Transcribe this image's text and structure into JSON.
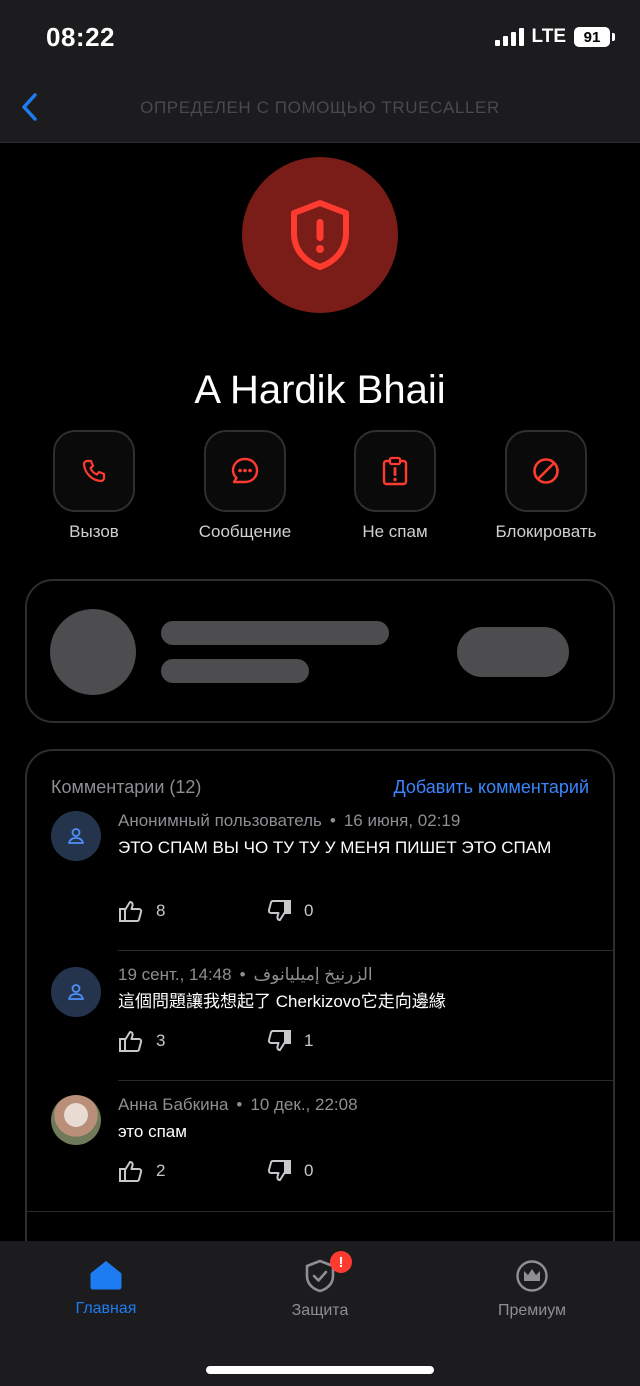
{
  "status": {
    "time": "08:22",
    "network": "LTE",
    "battery": "91"
  },
  "nav": {
    "title": "ОПРЕДЕЛЕН С ПОМОЩЬЮ TRUECALLER"
  },
  "contact": {
    "name": "A Hardik Bhaii"
  },
  "actions": [
    {
      "label": "Вызов",
      "icon": "phone-icon"
    },
    {
      "label": "Сообщение",
      "icon": "chat-bubble-icon"
    },
    {
      "label": "Не спам",
      "icon": "clipboard-alert-icon"
    },
    {
      "label": "Блокировать",
      "icon": "block-icon"
    }
  ],
  "comments": {
    "title": "Комментарии (12)",
    "add_label": "Добавить комментарий",
    "items": [
      {
        "author": "Анонимный пользователь",
        "date": "16 июня, 02:19",
        "text": "ЭТО СПАМ ВЫ ЧО ТУ ТУ  У МЕНЯ ПИШЕТ ЭТО СПАМ",
        "likes": "8",
        "dislikes": "0"
      },
      {
        "author": "الزرنيخ إميليانوف",
        "date": "19 сент., 14:48",
        "text": "這個問題讓我想起了 Cherkizovo它走向邊緣",
        "likes": "3",
        "dislikes": "1"
      },
      {
        "author": "Анна Бабкина",
        "date": "10 дек., 22:08",
        "text": "это спам",
        "likes": "2",
        "dislikes": "0"
      }
    ]
  },
  "tabs": [
    {
      "label": "Главная",
      "icon": "home-icon",
      "active": true
    },
    {
      "label": "Защита",
      "icon": "shield-check-icon",
      "badge": "!"
    },
    {
      "label": "Премиум",
      "icon": "crown-icon"
    }
  ],
  "colors": {
    "accent": "#3a86ff",
    "spam_red": "#ff3b30",
    "spam_circle": "#7a1c17",
    "background": "#000000"
  }
}
